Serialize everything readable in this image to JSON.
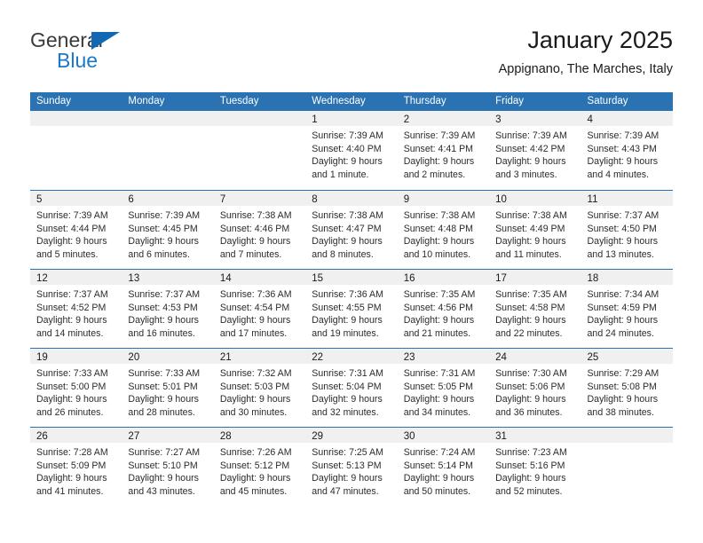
{
  "logo": {
    "word_top": "General",
    "word_bottom": "Blue",
    "triangle_icon": "triangle-icon",
    "color_dark": "#3a3a3a",
    "color_blue": "#1b77c8"
  },
  "header": {
    "title": "January 2025",
    "subtitle": "Appignano, The Marches, Italy"
  },
  "theme": {
    "header_blue": "#2b72b3",
    "day_band_gray": "#f0f0f0",
    "text_dark": "#1a1a1a"
  },
  "calendar": {
    "weekdays": [
      "Sunday",
      "Monday",
      "Tuesday",
      "Wednesday",
      "Thursday",
      "Friday",
      "Saturday"
    ],
    "weeks": [
      [
        {
          "day": "",
          "empty": true
        },
        {
          "day": "",
          "empty": true
        },
        {
          "day": "",
          "empty": true
        },
        {
          "day": "1",
          "sunrise": "Sunrise: 7:39 AM",
          "sunset": "Sunset: 4:40 PM",
          "daylight1": "Daylight: 9 hours",
          "daylight2": "and 1 minute."
        },
        {
          "day": "2",
          "sunrise": "Sunrise: 7:39 AM",
          "sunset": "Sunset: 4:41 PM",
          "daylight1": "Daylight: 9 hours",
          "daylight2": "and 2 minutes."
        },
        {
          "day": "3",
          "sunrise": "Sunrise: 7:39 AM",
          "sunset": "Sunset: 4:42 PM",
          "daylight1": "Daylight: 9 hours",
          "daylight2": "and 3 minutes."
        },
        {
          "day": "4",
          "sunrise": "Sunrise: 7:39 AM",
          "sunset": "Sunset: 4:43 PM",
          "daylight1": "Daylight: 9 hours",
          "daylight2": "and 4 minutes."
        }
      ],
      [
        {
          "day": "5",
          "sunrise": "Sunrise: 7:39 AM",
          "sunset": "Sunset: 4:44 PM",
          "daylight1": "Daylight: 9 hours",
          "daylight2": "and 5 minutes."
        },
        {
          "day": "6",
          "sunrise": "Sunrise: 7:39 AM",
          "sunset": "Sunset: 4:45 PM",
          "daylight1": "Daylight: 9 hours",
          "daylight2": "and 6 minutes."
        },
        {
          "day": "7",
          "sunrise": "Sunrise: 7:38 AM",
          "sunset": "Sunset: 4:46 PM",
          "daylight1": "Daylight: 9 hours",
          "daylight2": "and 7 minutes."
        },
        {
          "day": "8",
          "sunrise": "Sunrise: 7:38 AM",
          "sunset": "Sunset: 4:47 PM",
          "daylight1": "Daylight: 9 hours",
          "daylight2": "and 8 minutes."
        },
        {
          "day": "9",
          "sunrise": "Sunrise: 7:38 AM",
          "sunset": "Sunset: 4:48 PM",
          "daylight1": "Daylight: 9 hours",
          "daylight2": "and 10 minutes."
        },
        {
          "day": "10",
          "sunrise": "Sunrise: 7:38 AM",
          "sunset": "Sunset: 4:49 PM",
          "daylight1": "Daylight: 9 hours",
          "daylight2": "and 11 minutes."
        },
        {
          "day": "11",
          "sunrise": "Sunrise: 7:37 AM",
          "sunset": "Sunset: 4:50 PM",
          "daylight1": "Daylight: 9 hours",
          "daylight2": "and 13 minutes."
        }
      ],
      [
        {
          "day": "12",
          "sunrise": "Sunrise: 7:37 AM",
          "sunset": "Sunset: 4:52 PM",
          "daylight1": "Daylight: 9 hours",
          "daylight2": "and 14 minutes."
        },
        {
          "day": "13",
          "sunrise": "Sunrise: 7:37 AM",
          "sunset": "Sunset: 4:53 PM",
          "daylight1": "Daylight: 9 hours",
          "daylight2": "and 16 minutes."
        },
        {
          "day": "14",
          "sunrise": "Sunrise: 7:36 AM",
          "sunset": "Sunset: 4:54 PM",
          "daylight1": "Daylight: 9 hours",
          "daylight2": "and 17 minutes."
        },
        {
          "day": "15",
          "sunrise": "Sunrise: 7:36 AM",
          "sunset": "Sunset: 4:55 PM",
          "daylight1": "Daylight: 9 hours",
          "daylight2": "and 19 minutes."
        },
        {
          "day": "16",
          "sunrise": "Sunrise: 7:35 AM",
          "sunset": "Sunset: 4:56 PM",
          "daylight1": "Daylight: 9 hours",
          "daylight2": "and 21 minutes."
        },
        {
          "day": "17",
          "sunrise": "Sunrise: 7:35 AM",
          "sunset": "Sunset: 4:58 PM",
          "daylight1": "Daylight: 9 hours",
          "daylight2": "and 22 minutes."
        },
        {
          "day": "18",
          "sunrise": "Sunrise: 7:34 AM",
          "sunset": "Sunset: 4:59 PM",
          "daylight1": "Daylight: 9 hours",
          "daylight2": "and 24 minutes."
        }
      ],
      [
        {
          "day": "19",
          "sunrise": "Sunrise: 7:33 AM",
          "sunset": "Sunset: 5:00 PM",
          "daylight1": "Daylight: 9 hours",
          "daylight2": "and 26 minutes."
        },
        {
          "day": "20",
          "sunrise": "Sunrise: 7:33 AM",
          "sunset": "Sunset: 5:01 PM",
          "daylight1": "Daylight: 9 hours",
          "daylight2": "and 28 minutes."
        },
        {
          "day": "21",
          "sunrise": "Sunrise: 7:32 AM",
          "sunset": "Sunset: 5:03 PM",
          "daylight1": "Daylight: 9 hours",
          "daylight2": "and 30 minutes."
        },
        {
          "day": "22",
          "sunrise": "Sunrise: 7:31 AM",
          "sunset": "Sunset: 5:04 PM",
          "daylight1": "Daylight: 9 hours",
          "daylight2": "and 32 minutes."
        },
        {
          "day": "23",
          "sunrise": "Sunrise: 7:31 AM",
          "sunset": "Sunset: 5:05 PM",
          "daylight1": "Daylight: 9 hours",
          "daylight2": "and 34 minutes."
        },
        {
          "day": "24",
          "sunrise": "Sunrise: 7:30 AM",
          "sunset": "Sunset: 5:06 PM",
          "daylight1": "Daylight: 9 hours",
          "daylight2": "and 36 minutes."
        },
        {
          "day": "25",
          "sunrise": "Sunrise: 7:29 AM",
          "sunset": "Sunset: 5:08 PM",
          "daylight1": "Daylight: 9 hours",
          "daylight2": "and 38 minutes."
        }
      ],
      [
        {
          "day": "26",
          "sunrise": "Sunrise: 7:28 AM",
          "sunset": "Sunset: 5:09 PM",
          "daylight1": "Daylight: 9 hours",
          "daylight2": "and 41 minutes."
        },
        {
          "day": "27",
          "sunrise": "Sunrise: 7:27 AM",
          "sunset": "Sunset: 5:10 PM",
          "daylight1": "Daylight: 9 hours",
          "daylight2": "and 43 minutes."
        },
        {
          "day": "28",
          "sunrise": "Sunrise: 7:26 AM",
          "sunset": "Sunset: 5:12 PM",
          "daylight1": "Daylight: 9 hours",
          "daylight2": "and 45 minutes."
        },
        {
          "day": "29",
          "sunrise": "Sunrise: 7:25 AM",
          "sunset": "Sunset: 5:13 PM",
          "daylight1": "Daylight: 9 hours",
          "daylight2": "and 47 minutes."
        },
        {
          "day": "30",
          "sunrise": "Sunrise: 7:24 AM",
          "sunset": "Sunset: 5:14 PM",
          "daylight1": "Daylight: 9 hours",
          "daylight2": "and 50 minutes."
        },
        {
          "day": "31",
          "sunrise": "Sunrise: 7:23 AM",
          "sunset": "Sunset: 5:16 PM",
          "daylight1": "Daylight: 9 hours",
          "daylight2": "and 52 minutes."
        },
        {
          "day": "",
          "empty": true
        }
      ]
    ]
  }
}
